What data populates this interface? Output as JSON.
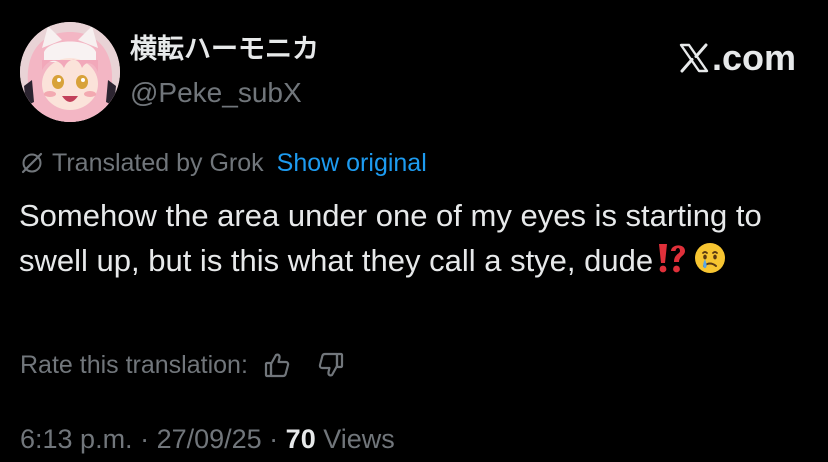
{
  "author": {
    "name": "横転ハーモニカ",
    "handle": "@Peke_subX"
  },
  "brand": {
    "domain": ".com",
    "icon": "x-logo-icon"
  },
  "translation": {
    "icon": "grok-icon",
    "label": "Translated by Grok",
    "show_original": "Show original"
  },
  "tweet": {
    "text": "Somehow the area under one of my eyes is starting to swell up, but is this what they call a stye, dude",
    "emojis": [
      "exclamation-question-mark-icon",
      "face-holding-back-tears-icon"
    ]
  },
  "rating": {
    "label": "Rate this translation:",
    "up_icon": "thumbs-up-icon",
    "down_icon": "thumbs-down-icon"
  },
  "meta": {
    "time": "6:13 p.m.",
    "separator": " · ",
    "date": "27/09/25",
    "views_count": "70",
    "views_label": " Views"
  },
  "colors": {
    "background": "#000000",
    "primary_text": "#e7e9ea",
    "secondary_text": "#71767b",
    "link": "#1d9bf0",
    "emoji_red": "#e0303a"
  }
}
